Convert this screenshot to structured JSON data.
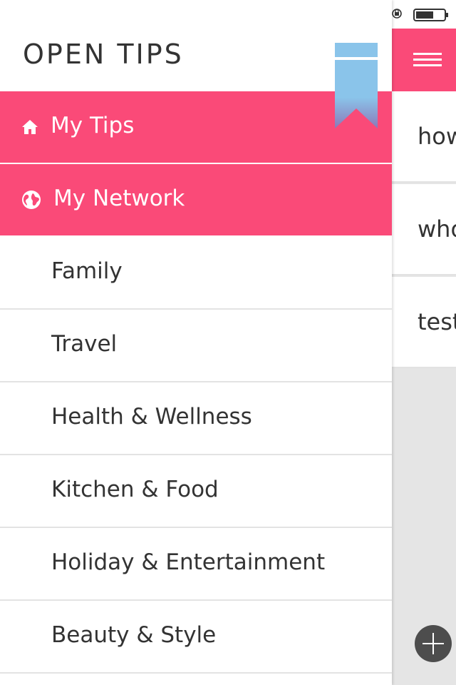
{
  "app": {
    "brand": "OPEN TIPS"
  },
  "drawer": {
    "primary": [
      {
        "label": "My Tips",
        "icon": "home-icon"
      },
      {
        "label": "My Network",
        "icon": "globe-icon"
      }
    ],
    "categories": [
      {
        "label": "Family"
      },
      {
        "label": "Travel"
      },
      {
        "label": "Health & Wellness"
      },
      {
        "label": "Kitchen & Food"
      },
      {
        "label": "Holiday & Entertainment"
      },
      {
        "label": "Beauty & Style"
      }
    ]
  },
  "main": {
    "tips": [
      {
        "title": "how"
      },
      {
        "title": "who"
      },
      {
        "title": "test"
      }
    ]
  },
  "colors": {
    "accent": "#fa4a78",
    "bookmark_top": "#8ac4ea",
    "bookmark_bottom": "#8b78b8",
    "fab": "#4d4d4d",
    "text": "#333333"
  },
  "icons": [
    "home-icon",
    "globe-icon",
    "bookmark-icon",
    "menu-icon",
    "add-icon",
    "battery-icon",
    "rotation-lock-icon"
  ]
}
